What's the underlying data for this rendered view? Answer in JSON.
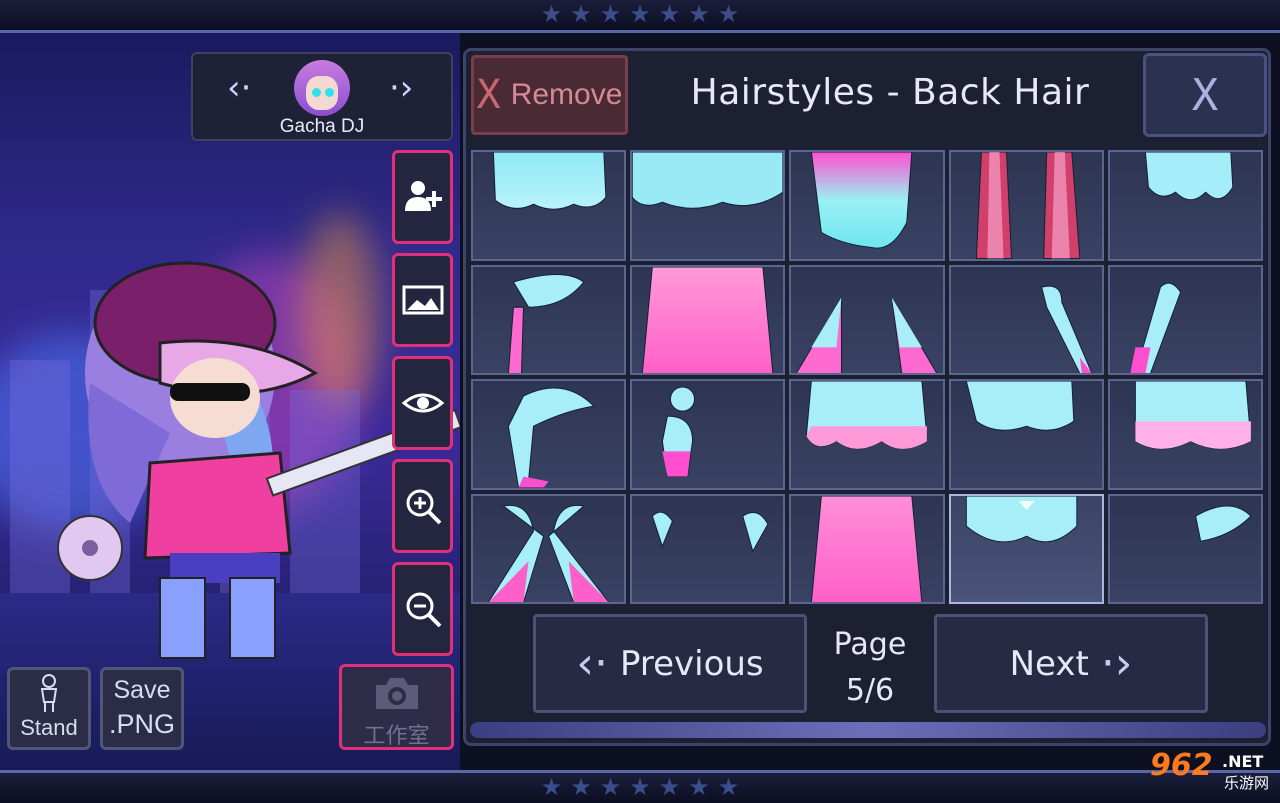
{
  "character": {
    "name": "Gacha DJ",
    "prev_arrow": "‹·",
    "next_arrow": "·›"
  },
  "side_buttons": [
    {
      "name": "add-character-icon"
    },
    {
      "name": "background-image-icon"
    },
    {
      "name": "eye-icon"
    },
    {
      "name": "zoom-in-icon"
    },
    {
      "name": "zoom-out-icon"
    }
  ],
  "bottom_left": {
    "stand_label": "Stand",
    "save_label_1": "Save",
    "save_label_2": ".PNG",
    "studio_label": "工作室"
  },
  "panel": {
    "remove_x": "X",
    "remove_label": "Remove",
    "title": "Hairstyles - Back Hair",
    "close_label": "X"
  },
  "grid": {
    "rows": 4,
    "cols": 5,
    "selected_index": 18
  },
  "pagination": {
    "previous_label": "Previous",
    "next_label": "Next",
    "page_label": "Page",
    "page_value": "5/6"
  },
  "watermark": {
    "big": "962",
    "net": ".NET",
    "cn": "乐游网"
  },
  "colors": {
    "accent_pink": "#e0307a",
    "panel_bg": "#1d1f33",
    "hair_cyan": "#7fe8f5",
    "hair_pink": "#ff5fc8"
  }
}
